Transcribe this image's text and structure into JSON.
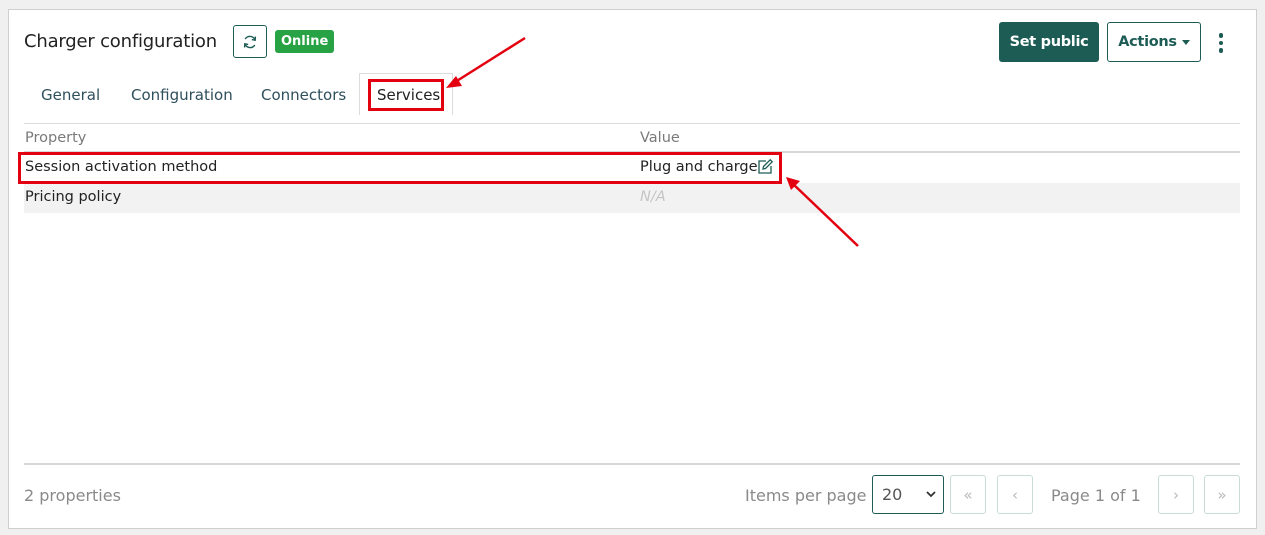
{
  "header": {
    "title": "Charger configuration",
    "status_badge": "Online",
    "set_public_label": "Set public",
    "actions_label": "Actions"
  },
  "tabs": [
    {
      "label": "General"
    },
    {
      "label": "Configuration"
    },
    {
      "label": "Connectors"
    },
    {
      "label": "Services",
      "active": true
    }
  ],
  "table": {
    "columns": [
      "Property",
      "Value"
    ],
    "rows": [
      {
        "property": "Session activation method",
        "value": "Plug and charge",
        "editable": true
      },
      {
        "property": "Pricing policy",
        "value": "N/A"
      }
    ]
  },
  "footer": {
    "count_text": "2 properties",
    "items_per_page_label": "Items per page",
    "items_per_page_value": "20",
    "page_info": "Page 1 of 1",
    "first_label": "«",
    "prev_label": "‹",
    "next_label": "›",
    "last_label": "»"
  },
  "colors": {
    "brand": "#1d5c55",
    "online": "#27a244",
    "annotation": "#e3000f"
  },
  "icons": [
    "refresh-icon",
    "caret-down-icon",
    "kebab-menu-icon",
    "edit-icon",
    "chevron-down-icon"
  ]
}
